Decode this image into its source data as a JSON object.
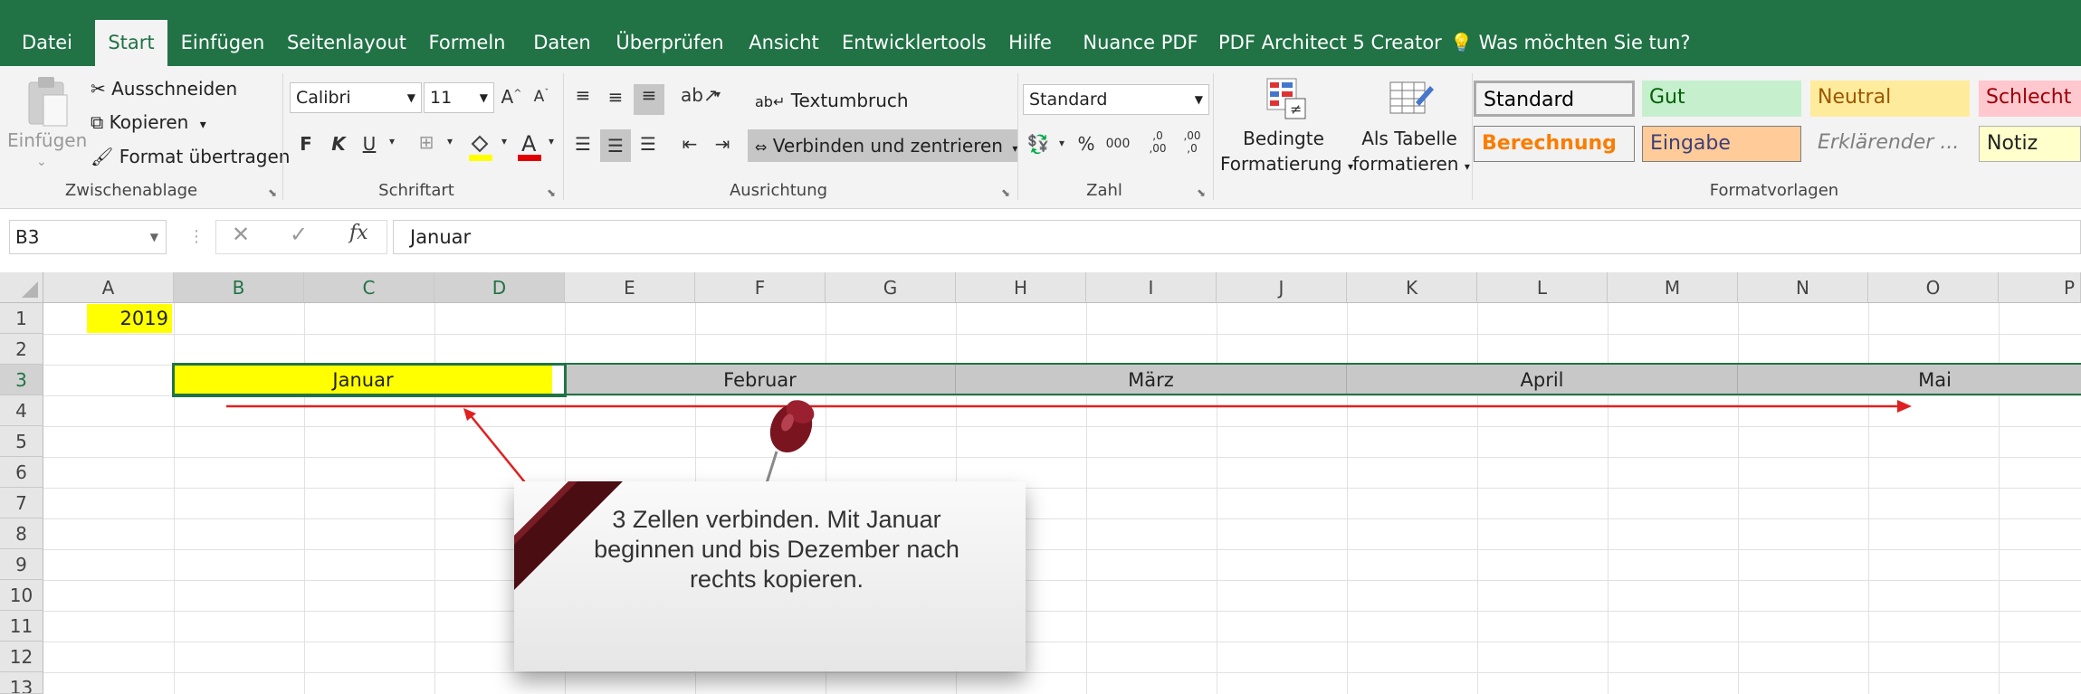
{
  "tabs": [
    "Datei",
    "Start",
    "Einfügen",
    "Seitenlayout",
    "Formeln",
    "Daten",
    "Überprüfen",
    "Ansicht",
    "Entwicklertools",
    "Hilfe",
    "Nuance PDF",
    "PDF Architect 5 Creator",
    "Was möchten Sie tun?"
  ],
  "ribbon": {
    "clipboard": {
      "paste": "Einfügen",
      "cut": "Ausschneiden",
      "copy": "Kopieren",
      "format_painter": "Format übertragen",
      "label": "Zwischenablage"
    },
    "font": {
      "name": "Calibri",
      "size": "11",
      "bold": "F",
      "italic": "K",
      "underline": "U",
      "label": "Schriftart"
    },
    "alignment": {
      "wrap": "Textumbruch",
      "merge": "Verbinden und zentrieren",
      "label": "Ausrichtung"
    },
    "number": {
      "format": "Standard",
      "percent": "%",
      "thousands": "000",
      "inc_decimal": ",0\n,00",
      "dec_decimal": ",00\n,0",
      "label": "Zahl"
    },
    "cond_format": {
      "line1": "Bedingte",
      "line2": "Formatierung"
    },
    "as_table": {
      "line1": "Als Tabelle",
      "line2": "formatieren"
    },
    "styles": {
      "label": "Formatvorlagen",
      "items": [
        {
          "name": "Standard",
          "color": "#222222",
          "bg": "#ffffff",
          "border": "#aaaaaa"
        },
        {
          "name": "Gut",
          "color": "#006100",
          "bg": "#c6efce",
          "border": "#c6efce"
        },
        {
          "name": "Neutral",
          "color": "#9c5700",
          "bg": "#ffeb9c",
          "border": "#ffeb9c"
        },
        {
          "name": "Schlecht",
          "color": "#9c0006",
          "bg": "#ffc7ce",
          "border": "#ffc7ce"
        },
        {
          "name": "Berechnung",
          "color": "#fa7d00",
          "bg": "#f2f2f2",
          "border": "#7f7f7f"
        },
        {
          "name": "Eingabe",
          "color": "#3f3f76",
          "bg": "#ffcc99",
          "border": "#7f7f7f"
        },
        {
          "name": "Erklärender ...",
          "color": "#7f7f7f",
          "bg": "#f3f3f3",
          "border": "#f3f3f3"
        },
        {
          "name": "Notiz",
          "color": "#222222",
          "bg": "#ffffcc",
          "border": "#b2b2b2"
        }
      ]
    }
  },
  "formula_bar": {
    "name_box": "B3",
    "fx": "fx",
    "content": "Januar"
  },
  "columns": [
    "A",
    "B",
    "C",
    "D",
    "E",
    "F",
    "G",
    "H",
    "I",
    "J",
    "K",
    "L",
    "M",
    "N",
    "O",
    "P"
  ],
  "rows": [
    "1",
    "2",
    "3",
    "4",
    "5",
    "6",
    "7",
    "8",
    "9",
    "10",
    "11",
    "12",
    "13"
  ],
  "cells": {
    "A1": "2019"
  },
  "months": [
    "Januar",
    "Februar",
    "März",
    "April",
    "Mai"
  ],
  "callout": {
    "text": "3 Zellen verbinden. Mit Januar beginnen und bis Dezember nach rechts kopieren."
  },
  "colors": {
    "accent": "#217346",
    "highlight": "#ffff00",
    "arrow": "#e02020",
    "pin": "#7a1520"
  }
}
